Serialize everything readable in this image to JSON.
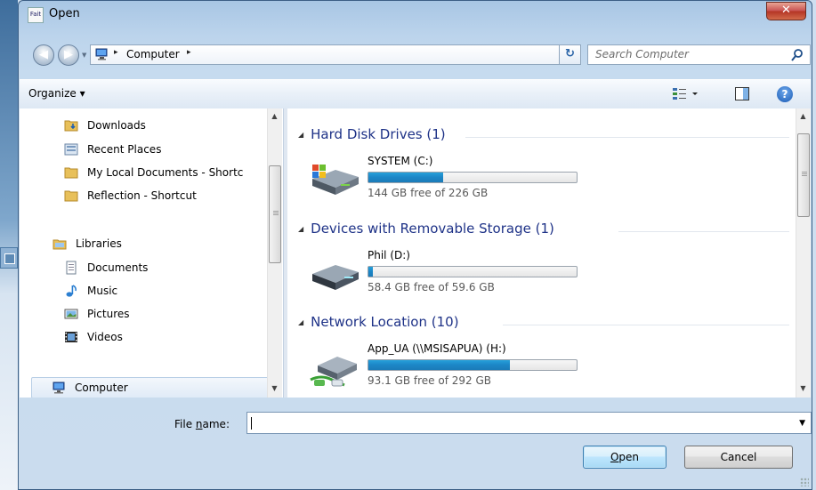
{
  "window": {
    "title": "Open",
    "app_icon_text": "Fait"
  },
  "address": {
    "crumb": "Computer",
    "separator": "▸",
    "search_placeholder": "Search Computer"
  },
  "toolbar": {
    "organize_label": "Organize ▾"
  },
  "nav_pane": {
    "favorites": [
      {
        "label": "Downloads",
        "icon": "downloads-folder-icon"
      },
      {
        "label": "Recent Places",
        "icon": "recent-places-icon"
      },
      {
        "label": "My Local Documents - Shortc",
        "icon": "folder-icon"
      },
      {
        "label": "Reflection - Shortcut",
        "icon": "folder-icon"
      }
    ],
    "libraries_label": "Libraries",
    "libraries": [
      {
        "label": "Documents",
        "icon": "documents-icon"
      },
      {
        "label": "Music",
        "icon": "music-icon"
      },
      {
        "label": "Pictures",
        "icon": "pictures-icon"
      },
      {
        "label": "Videos",
        "icon": "videos-icon"
      }
    ],
    "computer_label": "Computer"
  },
  "content": {
    "groups": [
      {
        "title": "Hard Disk Drives (1)",
        "drives": [
          {
            "name": "SYSTEM (C:)",
            "free": "144 GB free of 226 GB",
            "used_fraction": 0.36,
            "icon": "hard-drive-windows-icon"
          }
        ]
      },
      {
        "title": "Devices with Removable Storage (1)",
        "drives": [
          {
            "name": "Phil (D:)",
            "free": "58.4 GB free of 59.6 GB",
            "used_fraction": 0.02,
            "icon": "removable-drive-icon"
          }
        ]
      },
      {
        "title": "Network Location (10)",
        "drives": [
          {
            "name": "App_UA (\\\\MSISAPUA) (H:)",
            "free": "93.1 GB free of 292 GB",
            "used_fraction": 0.68,
            "icon": "network-drive-icon"
          }
        ]
      }
    ]
  },
  "footer": {
    "filename_label_pre": "File ",
    "filename_label_u": "n",
    "filename_label_post": "ame:",
    "filename_value": "",
    "open_u": "O",
    "open_rest": "pen",
    "cancel_label": "Cancel"
  },
  "colors": {
    "group_header": "#1e3287",
    "bar_fill": "#26a0da"
  }
}
